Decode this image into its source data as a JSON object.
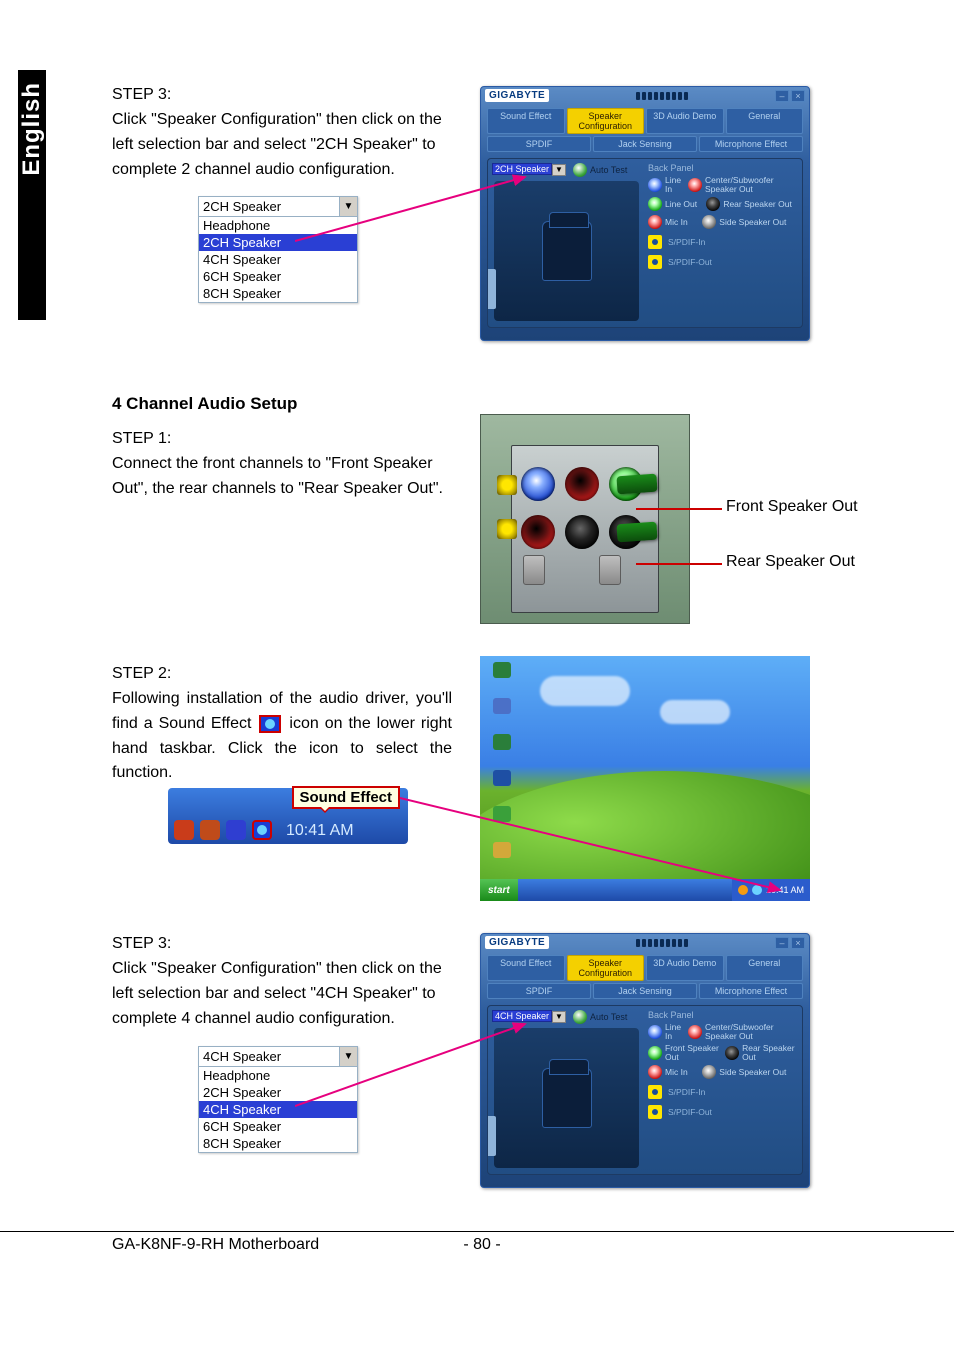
{
  "sideLabel": "English",
  "step3a": {
    "label": "STEP 3:",
    "text": "Click \"Speaker Configuration\" then click on the left selection bar and select \"2CH Speaker\" to complete 2 channel audio configuration."
  },
  "dropdown2ch": {
    "selected": "2CH Speaker",
    "items": [
      "Headphone",
      "2CH Speaker",
      "4CH Speaker",
      "6CH Speaker",
      "8CH Speaker"
    ],
    "highlightedIndex": 1
  },
  "panelA": {
    "brand": "GIGABYTE",
    "tabs": [
      "Sound Effect",
      "Speaker Configuration",
      "3D Audio Demo",
      "General",
      "SPDIF",
      "Jack Sensing",
      "Microphone Effect"
    ],
    "activeTabIndex": 1,
    "ddSelection": "2CH Speaker",
    "autoTest": "Auto Test",
    "backPanelLabel": "Back Panel",
    "portsLeft": [
      {
        "color": "blue",
        "label": "Line In"
      },
      {
        "color": "green",
        "label": "Line Out"
      },
      {
        "color": "red",
        "label": "Mic In"
      }
    ],
    "portsRight": [
      {
        "color": "red",
        "label": "Center/Subwoofer Speaker Out"
      },
      {
        "color": "black",
        "label": "Rear Speaker Out"
      },
      {
        "color": "grey",
        "label": "Side Speaker Out"
      }
    ],
    "spdif": [
      "S/PDIF-In",
      "S/PDIF-Out"
    ]
  },
  "sectionTitle": "4 Channel Audio Setup",
  "step1": {
    "label": "STEP 1:",
    "text": "Connect the front channels to \"Front Speaker Out\", the rear channels to \"Rear Speaker Out\"."
  },
  "backPanelCallouts": {
    "front": "Front Speaker Out",
    "rear": "Rear Speaker Out"
  },
  "step2": {
    "label": "STEP 2:",
    "textBefore": "Following installation of the audio driver, you'll find a Sound Effect ",
    "textAfter": " icon on the lower right hand taskbar.  Click the icon to select the function."
  },
  "taskbarFig": {
    "tooltip": "Sound Effect",
    "time": "10:41 AM",
    "startLabel": "start"
  },
  "step3b": {
    "label": "STEP 3:",
    "text": "Click \"Speaker Configuration\" then click on the left selection bar and select \"4CH Speaker\" to complete 4 channel audio configuration."
  },
  "dropdown4ch": {
    "selected": "4CH Speaker",
    "items": [
      "Headphone",
      "2CH Speaker",
      "4CH Speaker",
      "6CH Speaker",
      "8CH Speaker"
    ],
    "highlightedIndex": 2
  },
  "panelB": {
    "brand": "GIGABYTE",
    "tabs": [
      "Sound Effect",
      "Speaker Configuration",
      "3D Audio Demo",
      "General",
      "SPDIF",
      "Jack Sensing",
      "Microphone Effect"
    ],
    "activeTabIndex": 1,
    "ddSelection": "4CH Speaker",
    "autoTest": "Auto Test",
    "backPanelLabel": "Back Panel",
    "portsLeft": [
      {
        "color": "blue",
        "label": "Line In"
      },
      {
        "color": "green",
        "label": "Front Speaker Out"
      },
      {
        "color": "red",
        "label": "Mic In"
      }
    ],
    "portsRight": [
      {
        "color": "red",
        "label": "Center/Subwoofer Speaker Out"
      },
      {
        "color": "black",
        "label": "Rear Speaker Out"
      },
      {
        "color": "grey",
        "label": "Side Speaker Out"
      }
    ],
    "spdif": [
      "S/PDIF-In",
      "S/PDIF-Out"
    ]
  },
  "footer": {
    "left": "GA-K8NF-9-RH Motherboard",
    "center": "- 80 -"
  }
}
